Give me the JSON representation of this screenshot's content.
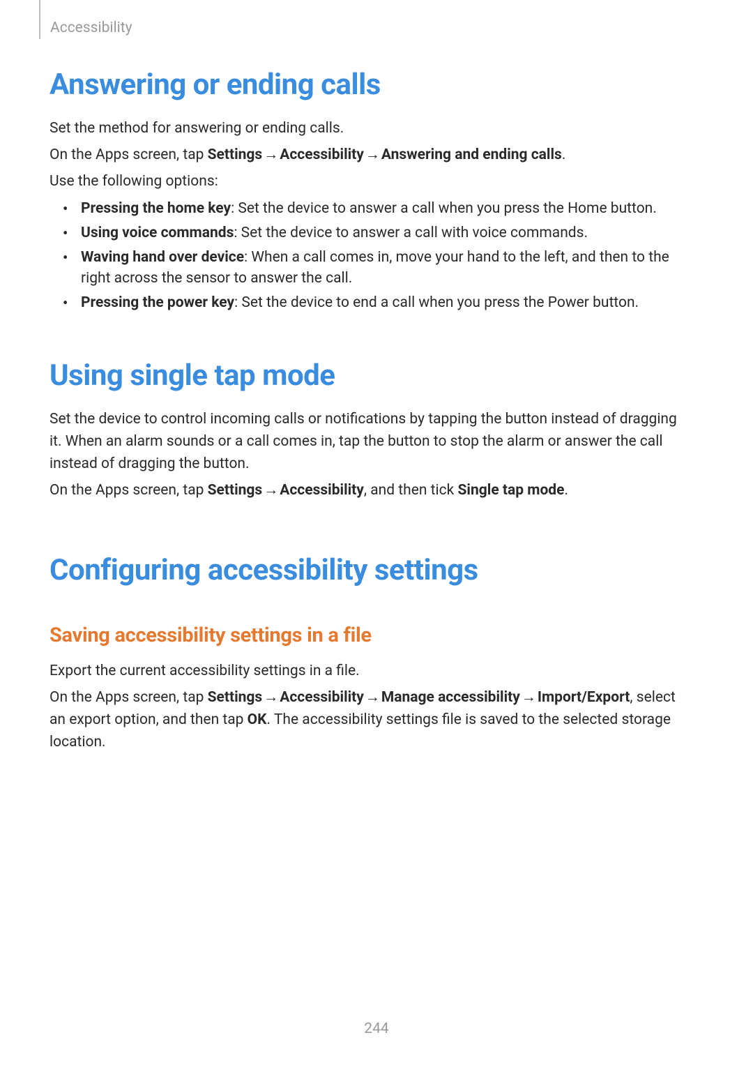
{
  "breadcrumb": "Accessibility",
  "page_number": "244",
  "section1": {
    "heading": "Answering or ending calls",
    "intro": "Set the method for answering or ending calls.",
    "nav_prefix": "On the Apps screen, tap ",
    "nav_settings": "Settings",
    "nav_accessibility": "Accessibility",
    "nav_target": "Answering and ending calls",
    "options_intro": "Use the following options:",
    "bullets": [
      {
        "label": "Pressing the home key",
        "desc": ": Set the device to answer a call when you press the Home button."
      },
      {
        "label": "Using voice commands",
        "desc": ": Set the device to answer a call with voice commands."
      },
      {
        "label": "Waving hand over device",
        "desc": ": When a call comes in, move your hand to the left, and then to the right across the sensor to answer the call."
      },
      {
        "label": "Pressing the power key",
        "desc": ": Set the device to end a call when you press the Power button."
      }
    ]
  },
  "section2": {
    "heading": "Using single tap mode",
    "para": "Set the device to control incoming calls or notifications by tapping the button instead of dragging it. When an alarm sounds or a call comes in, tap the button to stop the alarm or answer the call instead of dragging the button.",
    "nav_prefix": "On the Apps screen, tap ",
    "nav_settings": "Settings",
    "nav_accessibility": "Accessibility",
    "nav_middle": ", and then tick ",
    "nav_target": "Single tap mode",
    "nav_suffix": "."
  },
  "section3": {
    "heading": "Configuring accessibility settings",
    "sub_heading": "Saving accessibility settings in a file",
    "para": "Export the current accessibility settings in a file.",
    "nav_prefix": "On the Apps screen, tap ",
    "nav_settings": "Settings",
    "nav_accessibility": "Accessibility",
    "nav_manage": "Manage accessibility",
    "nav_import_export": "Import/Export",
    "nav_middle1": ", select an export option, and then tap ",
    "nav_ok": "OK",
    "nav_suffix": ". The accessibility settings file is saved to the selected storage location."
  },
  "arrow": "→"
}
